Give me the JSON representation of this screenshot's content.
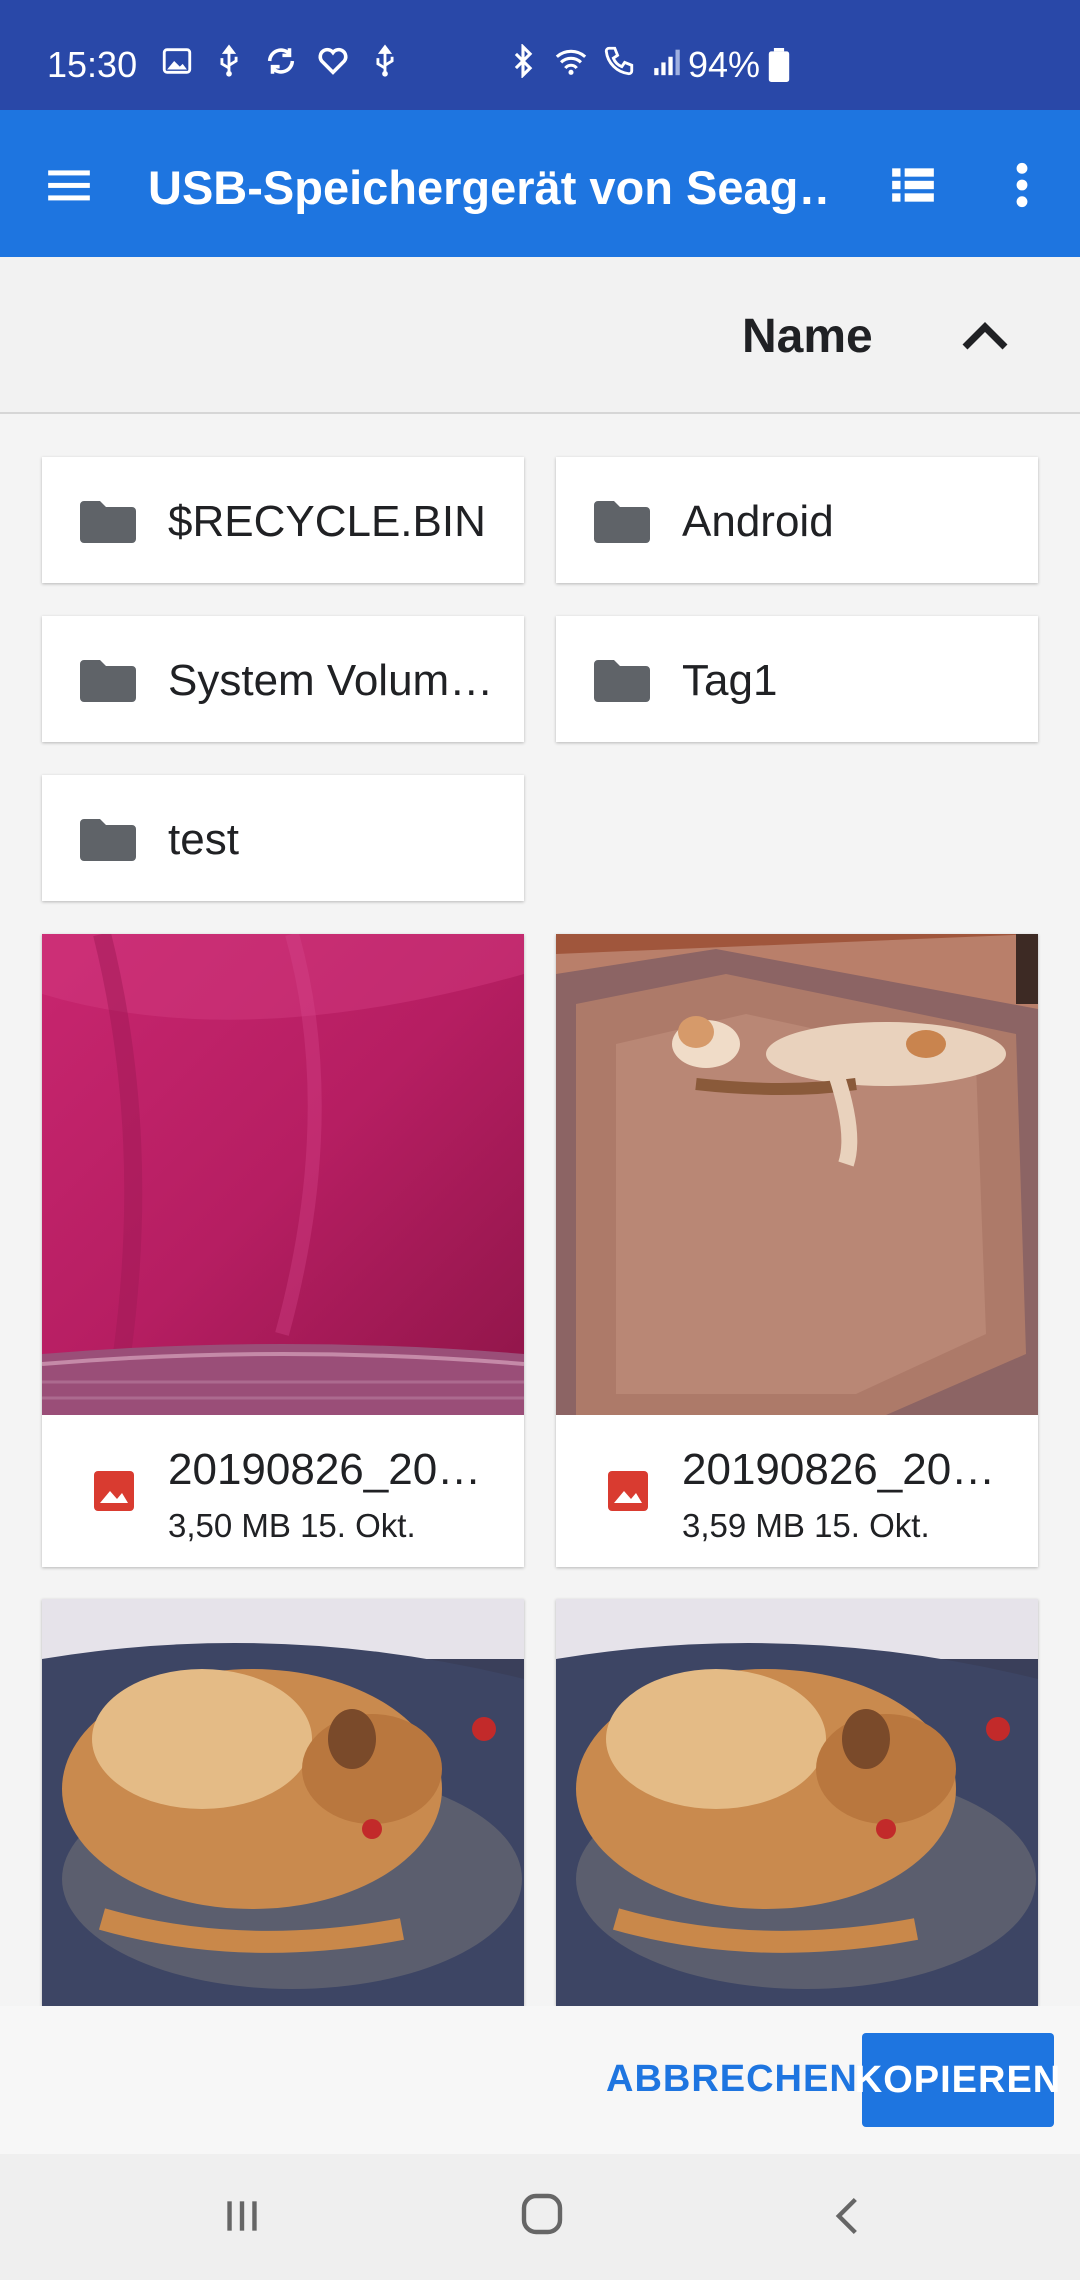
{
  "status_bar": {
    "time": "15:30",
    "battery_percent": "94%",
    "left_icons": [
      "image-icon",
      "usb-icon",
      "sync-icon",
      "heart-icon",
      "usb-icon"
    ],
    "right_icons": [
      "bluetooth-icon",
      "wifi-icon",
      "wifi-call-icon",
      "signal-icon",
      "battery-icon"
    ]
  },
  "app_bar": {
    "title": "USB-Speichergerät von Seag…",
    "menu_icon": "hamburger-menu-icon",
    "view_icon": "list-view-icon",
    "more_icon": "more-vert-icon"
  },
  "sort": {
    "label": "Name",
    "direction_icon": "chevron-up-icon"
  },
  "folders": [
    {
      "name": "$RECYCLE.BIN"
    },
    {
      "name": "Android"
    },
    {
      "name": "System Volum…"
    },
    {
      "name": "Tag1"
    },
    {
      "name": "test"
    }
  ],
  "files": [
    {
      "name": "20190826_20…",
      "info": "3,50 MB 15. Okt."
    },
    {
      "name": "20190826_20…",
      "info": "3,59 MB 15. Okt."
    }
  ],
  "actions": {
    "cancel": "ABBRECHEN",
    "copy": "KOPIEREN"
  },
  "colors": {
    "status_bar": "#2948a8",
    "app_bar": "#1e75e0",
    "accent": "#1e75e0",
    "image_icon": "#d93b30"
  }
}
